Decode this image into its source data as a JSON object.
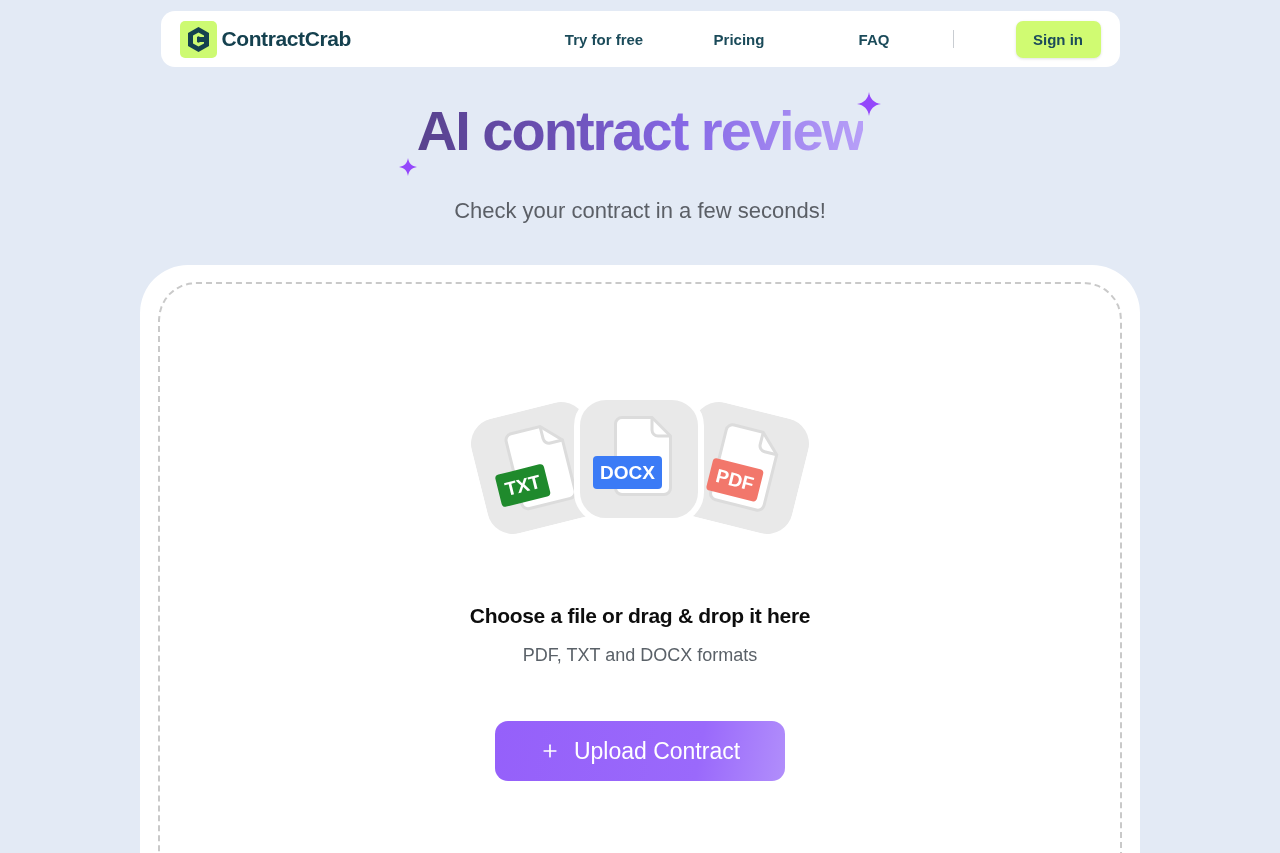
{
  "nav": {
    "brand": "ContractCrab",
    "links": [
      "Try for free",
      "Pricing",
      "FAQ"
    ],
    "sign_in": "Sign in"
  },
  "hero": {
    "title": "AI contract review",
    "subtitle": "Check your contract in a few seconds!"
  },
  "upload": {
    "file_types": [
      {
        "label": "TXT",
        "color": "#1f8a2c"
      },
      {
        "label": "DOCX",
        "color": "#3b7bf6"
      },
      {
        "label": "PDF",
        "color": "#f2776b"
      }
    ],
    "heading": "Choose a file or drag & drop it here",
    "formats": "PDF, TXT and DOCX formats",
    "button": "Upload Contract"
  }
}
